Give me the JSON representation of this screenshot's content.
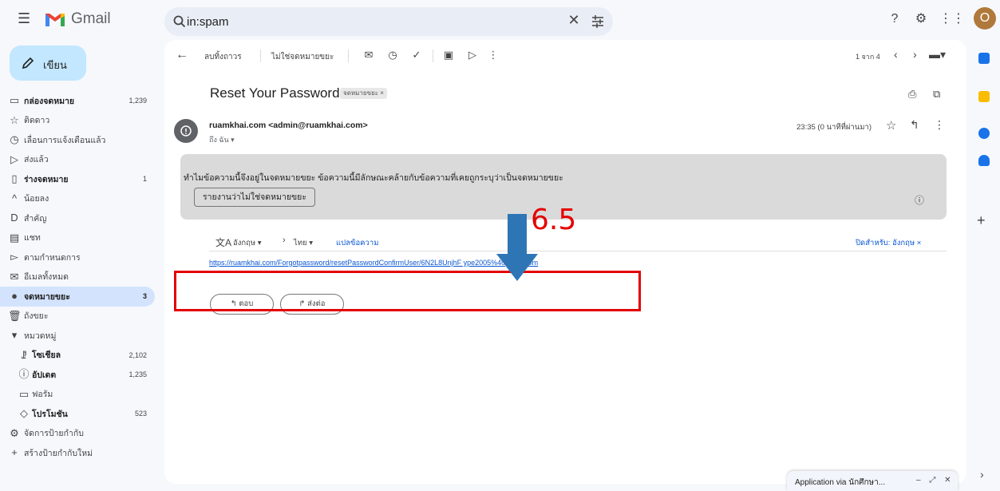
{
  "app": {
    "name": "Gmail",
    "avatar_letter": "O"
  },
  "search": {
    "value": "in:spam",
    "clear_glyph": "✕"
  },
  "compose": {
    "label": "เขียน"
  },
  "nav": [
    {
      "label": "กล่องจดหมาย",
      "count": "1,239",
      "bold": true,
      "icon": "▭"
    },
    {
      "label": "ติดดาว",
      "count": "",
      "icon": "☆"
    },
    {
      "label": "เลื่อนการแจ้งเตือนแล้ว",
      "count": "",
      "icon": "◷"
    },
    {
      "label": "ส่งแล้ว",
      "count": "",
      "icon": "▷"
    },
    {
      "label": "ร่างจดหมาย",
      "count": "1",
      "bold": true,
      "icon": "▯"
    },
    {
      "label": "น้อยลง",
      "count": "",
      "icon": "^"
    },
    {
      "label": "สำคัญ",
      "count": "",
      "icon": "D"
    },
    {
      "label": "แชท",
      "count": "",
      "icon": "▤"
    },
    {
      "label": "ตามกำหนดการ",
      "count": "",
      "icon": "▻"
    },
    {
      "label": "อีเมลทั้งหมด",
      "count": "",
      "icon": "✉"
    },
    {
      "label": "จดหมายขยะ",
      "count": "3",
      "active": true,
      "icon": "●"
    },
    {
      "label": "ถังขยะ",
      "count": "",
      "icon": "🗑"
    },
    {
      "label": "หมวดหมู่",
      "count": "",
      "icon": "▾"
    },
    {
      "label": "โซเชียล",
      "count": "2,102",
      "bold": true,
      "sub": true,
      "icon": "ꗗ"
    },
    {
      "label": "อัปเดต",
      "count": "1,235",
      "bold": true,
      "sub": true,
      "icon": "ⓘ"
    },
    {
      "label": "ฟอรัม",
      "count": "",
      "sub": true,
      "icon": "▭"
    },
    {
      "label": "โปรโมชัน",
      "count": "523",
      "bold": true,
      "sub": true,
      "icon": "◇"
    },
    {
      "label": "จัดการป้ายกำกับ",
      "count": "",
      "icon": "⚙"
    },
    {
      "label": "สร้างป้ายกำกับใหม่",
      "count": "",
      "icon": "+"
    }
  ],
  "toolbar": {
    "delete_forever": "ลบทิ้งถาวร",
    "not_spam": "ไม่ใช่จดหมายขยะ",
    "pages": "1 จาก 4"
  },
  "email": {
    "subject": "Reset Your Password",
    "label_chip": "จดหมายขยะ ×",
    "sender": "ruamkhai.com <admin@ruamkhai.com>",
    "to": "ถึง ฉัน ▾",
    "time": "23:35 (0 นาทีที่ผ่านมา)",
    "spam_notice": "ทำไมข้อความนี้จึงอยู่ในจดหมายขยะ ข้อความนี้มีลักษณะคล้ายกับข้อความที่เคยถูกระบุว่าเป็นจดหมายขยะ",
    "report_not_spam": "รายงานว่าไม่ใช่จดหมายขยะ",
    "translate_from": "อังกฤษ ▾",
    "translate_to": "ไทย ▾",
    "translate_link": "แปลข้อความ",
    "translate_off": "ปิดสำหรับ: อังกฤษ ×",
    "link": "https://ruamkhai.com/Forgotpassword/resetPasswordConfirmUser/6N2L8UnjhF                    ype2005%40gmail.com",
    "reply": "↰ ตอบ",
    "forward": "↱ ส่งต่อ"
  },
  "annotation": {
    "step": "6.5",
    "box_color": "#e40000",
    "arrow_color": "#2e75b6"
  },
  "float_panel": {
    "title": "Application via นักศึกษา...",
    "controls": "–  ⤢  ✕"
  }
}
